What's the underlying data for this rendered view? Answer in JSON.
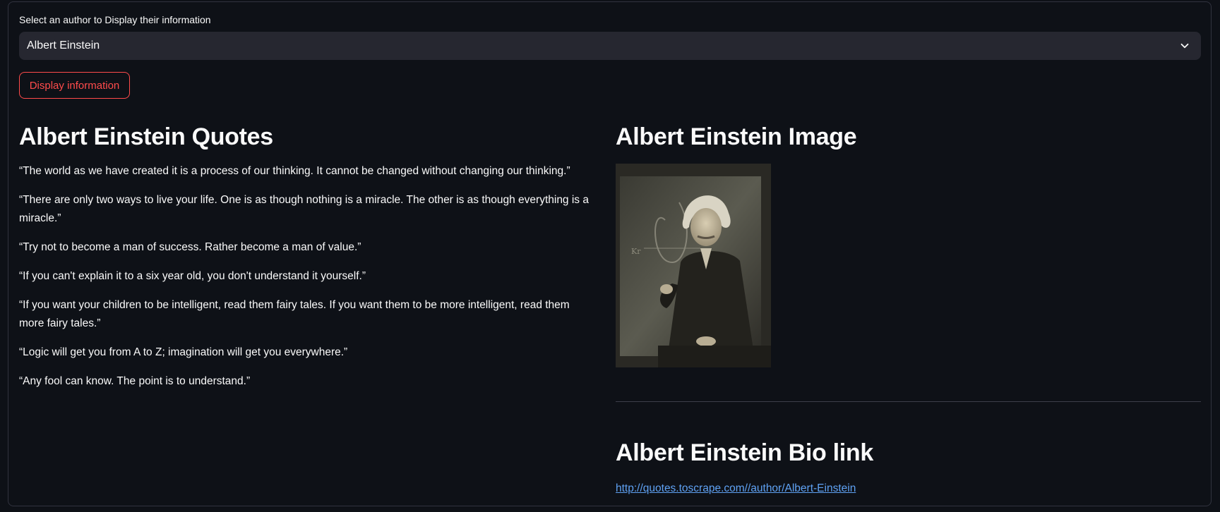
{
  "author_select": {
    "label": "Select an author to Display their information",
    "selected": "Albert Einstein"
  },
  "display_button": {
    "label": "Display information"
  },
  "quotes_section": {
    "title": "Albert Einstein Quotes",
    "quotes": [
      "“The world as we have created it is a process of our thinking. It cannot be changed without changing our thinking.”",
      "“There are only two ways to live your life. One is as though nothing is a miracle. The other is as though everything is a miracle.”",
      "“Try not to become a man of success. Rather become a man of value.”",
      "“If you can't explain it to a six year old, you don't understand it yourself.”",
      "“If you want your children to be intelligent, read them fairy tales. If you want them to be more intelligent, read them more fairy tales.”",
      "“Logic will get you from A to Z; imagination will get you everywhere.”",
      "“Any fool can know. The point is to understand.”"
    ]
  },
  "image_section": {
    "title": "Albert Einstein Image"
  },
  "bio_section": {
    "title": "Albert Einstein Bio link",
    "link_text": "http://quotes.toscrape.com//author/Albert-Einstein"
  },
  "colors": {
    "background": "#0e1117",
    "select_bg": "#262730",
    "accent": "#ff4b4b",
    "link": "#5fa2f4"
  }
}
